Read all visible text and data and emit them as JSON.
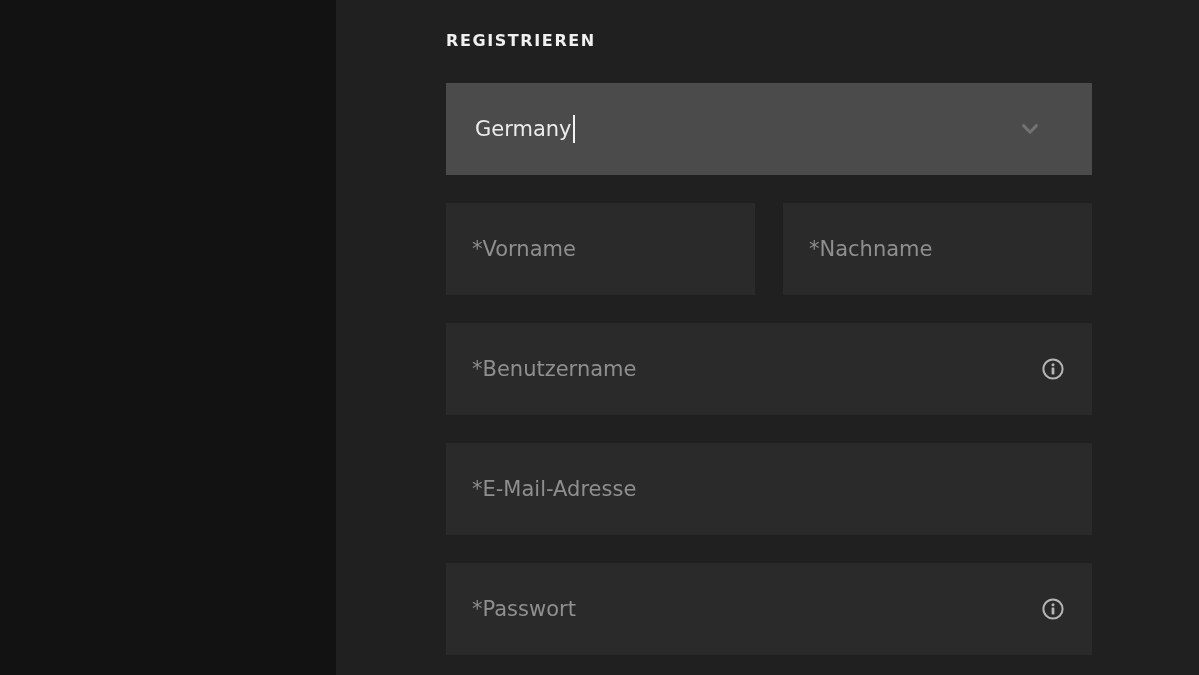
{
  "form": {
    "title": "REGISTRIEREN",
    "country": {
      "value": "Germany",
      "focused": true
    },
    "rows": [
      {
        "fields": [
          {
            "placeholder": "*Vorname",
            "info": false
          },
          {
            "placeholder": "*Nachname",
            "info": false
          }
        ]
      },
      {
        "fields": [
          {
            "placeholder": "*Benutzername",
            "info": true
          }
        ]
      },
      {
        "fields": [
          {
            "placeholder": "*E-Mail-Adresse",
            "info": false
          }
        ]
      },
      {
        "fields": [
          {
            "placeholder": "*Passwort",
            "info": true
          }
        ]
      }
    ]
  }
}
